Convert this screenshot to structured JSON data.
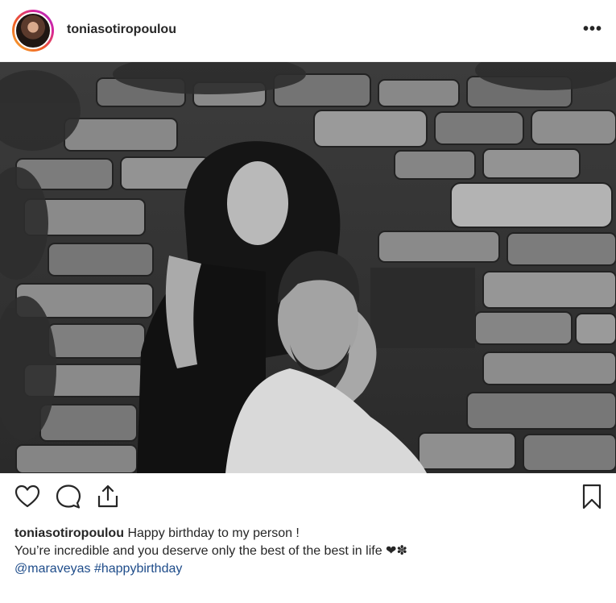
{
  "post": {
    "username": "toniasotiropoulou",
    "more_label": "•••",
    "caption": {
      "author": "toniasotiropoulou",
      "line1": "Happy birthday to my person !",
      "line2": "You’re incredible and you deserve only the best of the best in life",
      "emojis": "❤✽",
      "mention": "@maraveyas",
      "hashtag": "#happybirthday"
    },
    "actions": [
      "heart-icon",
      "comment-icon",
      "share-icon",
      "bookmark-icon"
    ],
    "photo_style": "black-and-white"
  },
  "colors": {
    "text": "#262626",
    "link": "#1e4c8a",
    "divider": "#efefef"
  }
}
